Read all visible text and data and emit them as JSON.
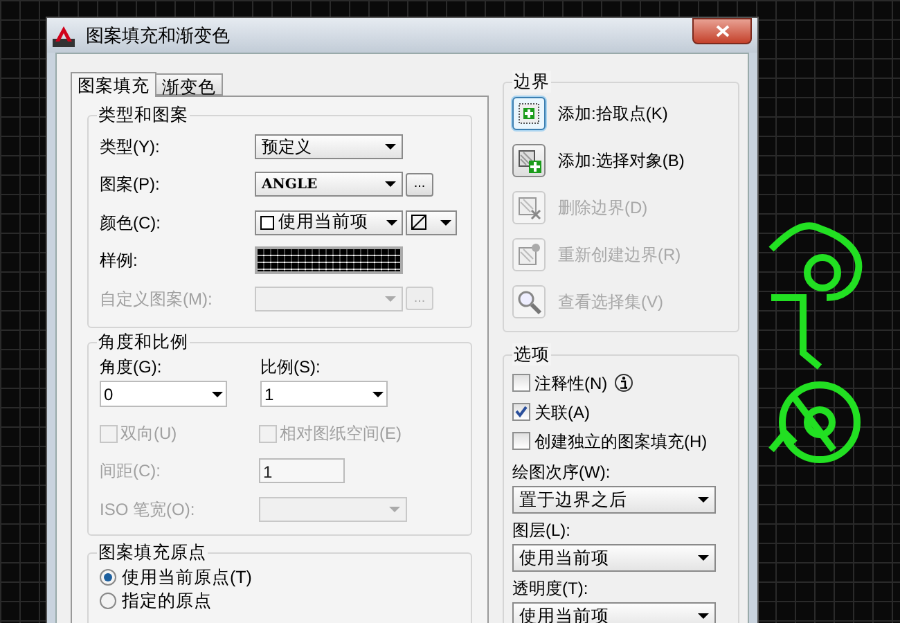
{
  "window": {
    "title": "图案填充和渐变色"
  },
  "tabs": [
    {
      "label": "图案填充",
      "selected": true
    },
    {
      "label": "渐变色",
      "selected": false
    }
  ],
  "type_and_pattern": {
    "title": "类型和图案",
    "fields": [
      {
        "kind": "dropdown",
        "label": "类型(Y):",
        "value": "预定义",
        "disabled": false
      },
      {
        "kind": "dropdown_browse",
        "label": "图案(P):",
        "value": "ANGLE",
        "browse": "...",
        "disabled": false
      },
      {
        "kind": "color",
        "label": "颜色(C):",
        "value": "使用当前项",
        "disabled": false
      },
      {
        "kind": "swatch",
        "label": "样例:"
      },
      {
        "kind": "dropdown_browse",
        "label": "自定义图案(M):",
        "browse": "...",
        "disabled": true
      }
    ]
  },
  "angle_and_scale": {
    "title": "角度和比例",
    "angle": {
      "label": "角度(G):",
      "value": "0"
    },
    "scale": {
      "label": "比例(S):",
      "value": "1"
    },
    "checks": [
      {
        "label": "双向(U)",
        "checked": false,
        "disabled": true
      },
      {
        "label": "相对图纸空间(E)",
        "checked": false,
        "disabled": true
      }
    ],
    "spacing": {
      "label": "间距(C):",
      "value": "1",
      "disabled": true
    },
    "iso_pen_width": {
      "label": "ISO 笔宽(O):",
      "disabled": true
    }
  },
  "origin": {
    "title": "图案填充原点",
    "options": [
      {
        "label": "使用当前原点(T)",
        "selected": true
      },
      {
        "label": "指定的原点",
        "selected": false
      }
    ]
  },
  "boundaries": {
    "title": "边界",
    "buttons": [
      {
        "kind": "pick",
        "label": "添加:拾取点(K)",
        "disabled": false,
        "focused": true
      },
      {
        "kind": "select",
        "label": "添加:选择对象(B)",
        "disabled": false,
        "focused": false
      },
      {
        "kind": "remove",
        "label": "删除边界(D)",
        "disabled": true,
        "focused": false
      },
      {
        "kind": "recreate",
        "label": "重新创建边界(R)",
        "disabled": true,
        "focused": false
      },
      {
        "kind": "view",
        "label": "查看选择集(V)",
        "disabled": true,
        "focused": false
      }
    ]
  },
  "options": {
    "title": "选项",
    "checks": [
      {
        "label": "注释性(N)",
        "checked": false,
        "info": true
      },
      {
        "label": "关联(A)",
        "checked": true,
        "info": false
      },
      {
        "label": "创建独立的图案填充(H)",
        "checked": false,
        "info": false
      }
    ],
    "dropdowns": [
      {
        "label": "绘图次序(W):",
        "value": "置于边界之后"
      },
      {
        "label": "图层(L):",
        "value": "使用当前项"
      },
      {
        "label": "透明度(T):",
        "value": "使用当前项"
      }
    ]
  }
}
